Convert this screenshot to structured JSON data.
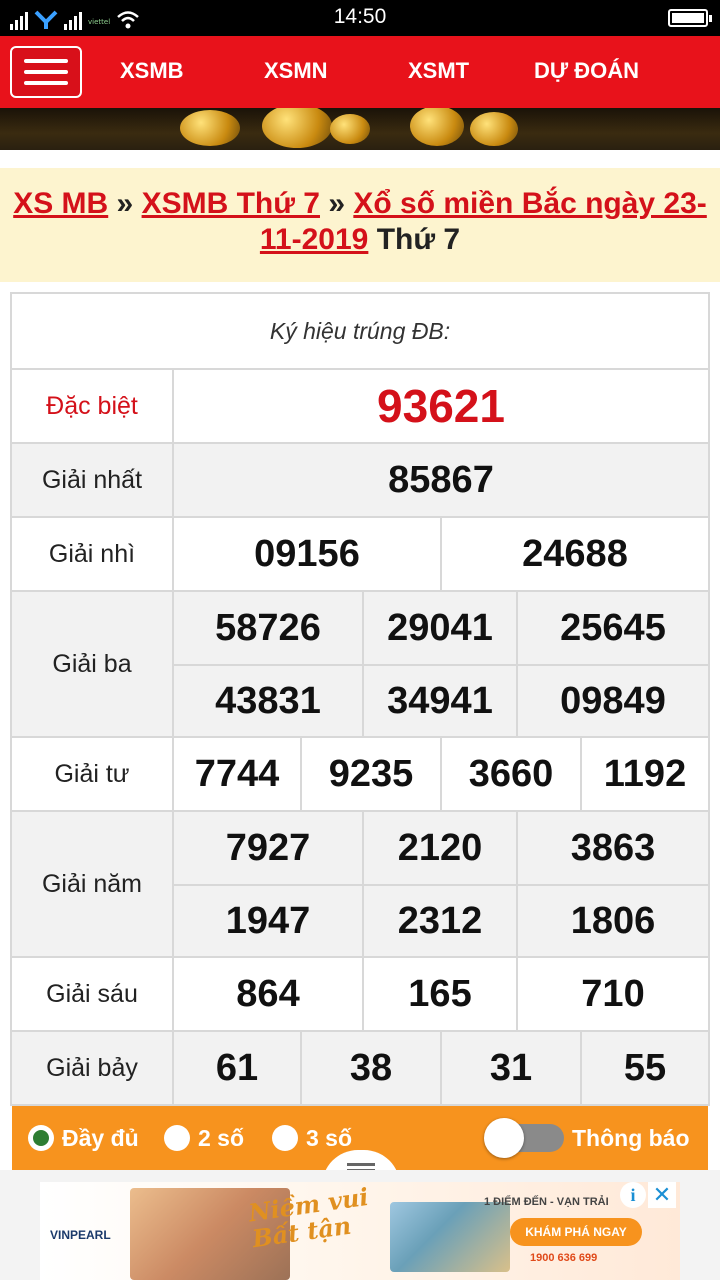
{
  "status_bar": {
    "time": "14:50",
    "carrier": "viettel"
  },
  "nav": {
    "menu_icon": "hamburger-icon",
    "items": [
      {
        "label": "XSMB"
      },
      {
        "label": "XSMN"
      },
      {
        "label": "XSMT"
      },
      {
        "label": "DỰ ĐOÁN"
      }
    ]
  },
  "breadcrumb": {
    "link1": "XS MB",
    "sep1": " » ",
    "link2": "XSMB Thứ 7",
    "sep2": " » ",
    "link3": "Xổ số miền Bắc ngày 23-11-2019",
    "suffix": " Thứ 7"
  },
  "results": {
    "symbol_label": "Ký hiệu trúng ĐB:",
    "prizes": [
      {
        "name": "Đặc biệt",
        "lines": [
          [
            "93621"
          ]
        ]
      },
      {
        "name": "Giải nhất",
        "lines": [
          [
            "85867"
          ]
        ]
      },
      {
        "name": "Giải nhì",
        "lines": [
          [
            "09156",
            "24688"
          ]
        ]
      },
      {
        "name": "Giải ba",
        "lines": [
          [
            "58726",
            "29041",
            "25645"
          ],
          [
            "43831",
            "34941",
            "09849"
          ]
        ]
      },
      {
        "name": "Giải tư",
        "lines": [
          [
            "7744",
            "9235",
            "3660",
            "1192"
          ]
        ]
      },
      {
        "name": "Giải năm",
        "lines": [
          [
            "7927",
            "2120",
            "3863"
          ],
          [
            "1947",
            "2312",
            "1806"
          ]
        ]
      },
      {
        "name": "Giải sáu",
        "lines": [
          [
            "864",
            "165",
            "710"
          ]
        ]
      },
      {
        "name": "Giải bảy",
        "lines": [
          [
            "61",
            "38",
            "31",
            "55"
          ]
        ]
      }
    ]
  },
  "options": {
    "full": "Đầy đủ",
    "two": "2 số",
    "three": "3 số",
    "selected": "full",
    "notify_label": "Thông báo",
    "notify_on": false
  },
  "ad": {
    "brand": "VINPEARL",
    "slogan": "Niềm vui Bất tận",
    "headline": "1 ĐIỂM ĐẾN - VẠN TRẢI",
    "cta": "KHÁM PHÁ NGAY",
    "phone": "1900 636 699",
    "info_icon": "info-icon",
    "close_icon": "close-icon"
  },
  "colors": {
    "nav_red": "#e8121b",
    "special_red": "#d4111a",
    "option_orange": "#f7931e",
    "breadcrumb_bg": "#fdf4cf"
  }
}
